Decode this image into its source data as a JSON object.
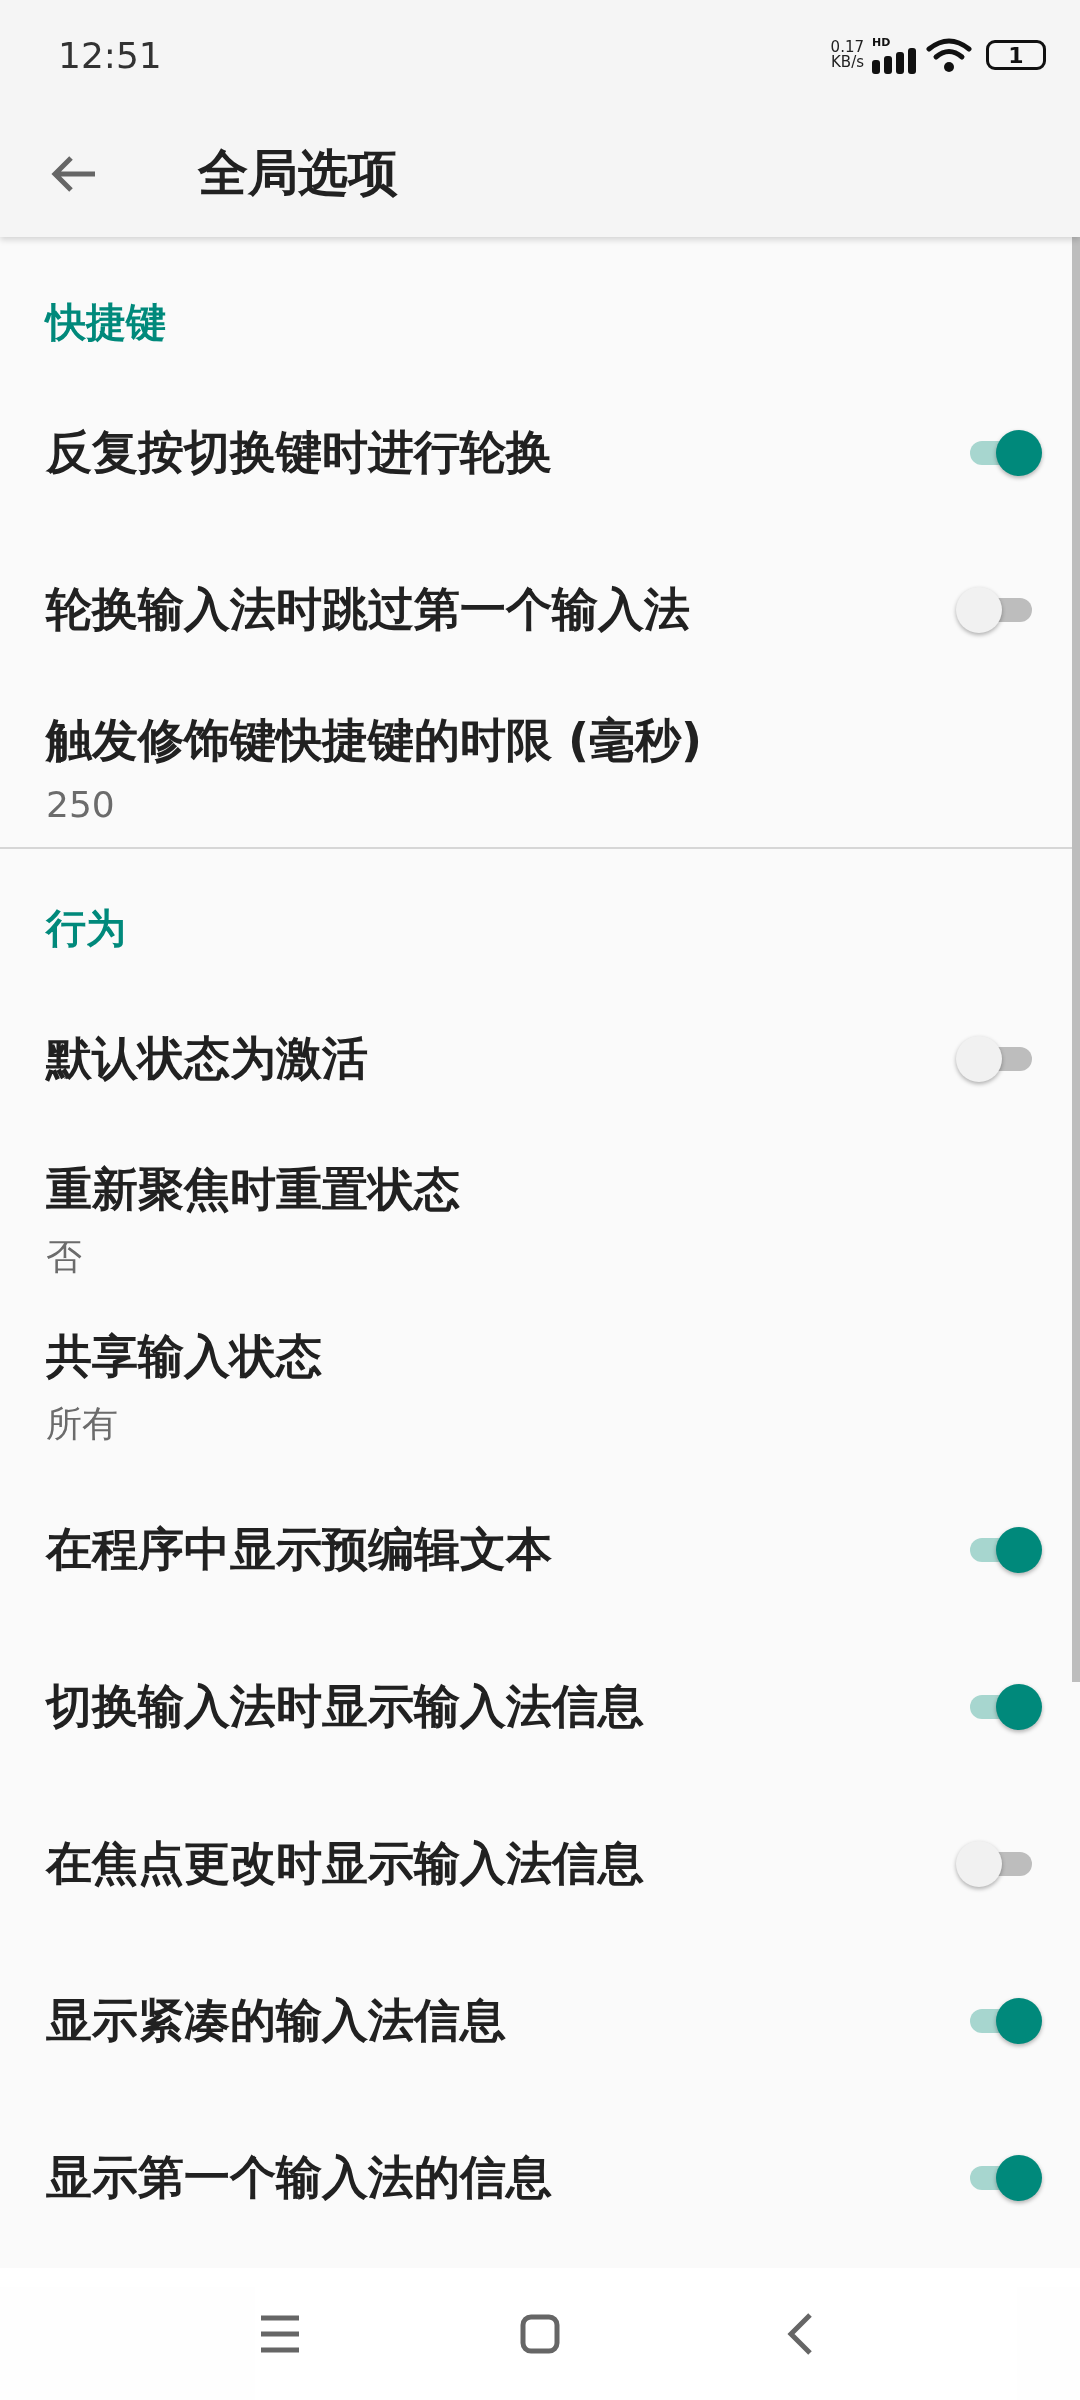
{
  "status_bar": {
    "time": "12:51",
    "speed_value": "0.17",
    "speed_unit": "KB/s",
    "network_label": "HD",
    "battery": "1"
  },
  "app_bar": {
    "title": "全局选项"
  },
  "sections": [
    {
      "title": "快捷键",
      "items": [
        {
          "kind": "switch",
          "title": "反复按切换键时进行轮换",
          "on": true
        },
        {
          "kind": "switch",
          "title": "轮换输入法时跳过第一个输入法",
          "on": false
        },
        {
          "kind": "value",
          "title": "触发修饰键快捷键的时限 (毫秒)",
          "value": "250"
        }
      ]
    },
    {
      "title": "行为",
      "items": [
        {
          "kind": "switch",
          "title": "默认状态为激活",
          "on": false
        },
        {
          "kind": "value",
          "title": "重新聚焦时重置状态",
          "value": "否"
        },
        {
          "kind": "value",
          "title": "共享输入状态",
          "value": "所有"
        },
        {
          "kind": "switch",
          "title": "在程序中显示预编辑文本",
          "on": true
        },
        {
          "kind": "switch",
          "title": "切换输入法时显示输入法信息",
          "on": true
        },
        {
          "kind": "switch",
          "title": "在焦点更改时显示输入法信息",
          "on": false
        },
        {
          "kind": "switch",
          "title": "显示紧凑的输入法信息",
          "on": true
        },
        {
          "kind": "switch",
          "title": "显示第一个输入法的信息",
          "on": true
        }
      ]
    }
  ]
}
